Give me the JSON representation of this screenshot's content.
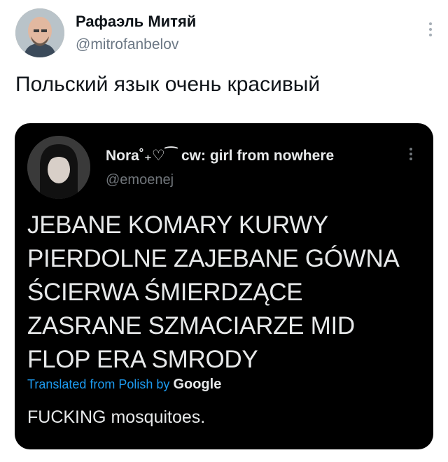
{
  "outer_tweet": {
    "author_name": "Рафаэль Митяй",
    "handle": "@mitrofanbelov",
    "text": "Польский язык очень красивый"
  },
  "quoted_tweet": {
    "author_name": "Nora˚₊♡⁀ cw: girl from nowhere",
    "handle": "@emoenej",
    "lines": [
      "JEBANE KOMARY KURWY",
      "PIERDOLNE ZAJEBANE GÓWNA",
      "ŚCIERWA ŚMIERDZĄCE",
      "ZASRANE SZMACIARZE MID",
      "FLOP ERA SMRODY"
    ],
    "translated_label": "Translated from Polish by",
    "translator": "Google",
    "translation": "FUCKING mosquitoes."
  },
  "colors": {
    "link": "#1d9bf0",
    "embed_background": "#000000"
  },
  "icons": {
    "more": "more-vertical-icon"
  }
}
